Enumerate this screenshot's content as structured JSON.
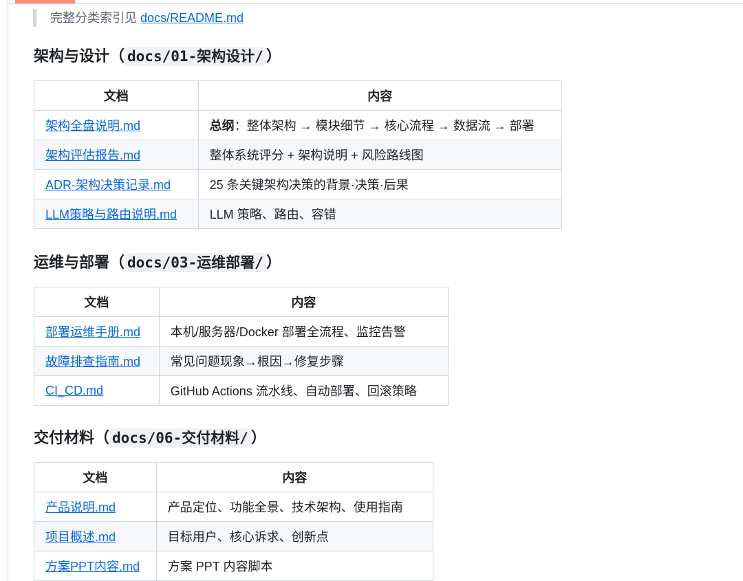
{
  "quote": {
    "text": "完整分类索引见 ",
    "link": "docs/README.md"
  },
  "sections": [
    {
      "heading_prefix": "架构与设计（",
      "heading_code": "docs/01-架构设计/",
      "heading_suffix": "）",
      "columns": [
        "文档",
        "内容"
      ],
      "rows": [
        {
          "doc": "架构全盘说明.md",
          "bold": "总纲",
          "content": "：整体架构 → 模块细节 → 核心流程 → 数据流 → 部署"
        },
        {
          "doc": "架构评估报告.md",
          "content": "整体系统评分 + 架构说明 + 风险路线图"
        },
        {
          "doc": "ADR-架构决策记录.md",
          "content": "25 条关键架构决策的背景·决策·后果"
        },
        {
          "doc": "LLM策略与路由说明.md",
          "content": "LLM 策略、路由、容错"
        }
      ]
    },
    {
      "heading_prefix": "运维与部署（",
      "heading_code": "docs/03-运维部署/",
      "heading_suffix": "）",
      "columns": [
        "文档",
        "内容"
      ],
      "rows": [
        {
          "doc": "部署运维手册.md",
          "content": "本机/服务器/Docker 部署全流程、监控告警"
        },
        {
          "doc": "故障排查指南.md",
          "content": "常见问题现象→根因→修复步骤"
        },
        {
          "doc": "CI_CD.md",
          "content": "GitHub Actions 流水线、自动部署、回滚策略"
        }
      ]
    },
    {
      "heading_prefix": "交付材料（",
      "heading_code": "docs/06-交付材料/",
      "heading_suffix": "）",
      "columns": [
        "文档",
        "内容"
      ],
      "rows": [
        {
          "doc": "产品说明.md",
          "content": "产品定位、功能全景、技术架构、使用指南"
        },
        {
          "doc": "项目概述.md",
          "content": "目标用户、核心诉求、创新点"
        },
        {
          "doc": "方案PPT内容.md",
          "content": "方案 PPT 内容脚本"
        }
      ]
    }
  ]
}
